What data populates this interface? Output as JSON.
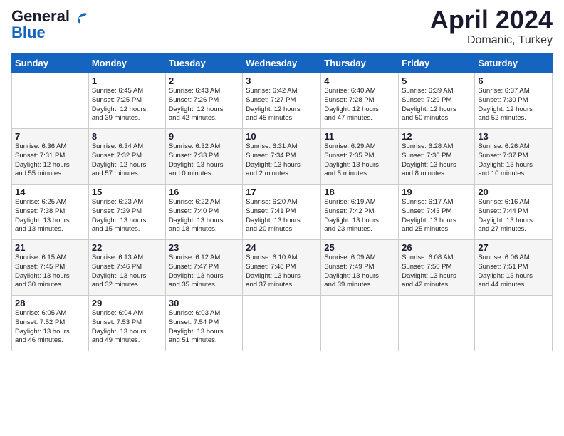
{
  "logo": {
    "part1": "General",
    "part2": "Blue"
  },
  "title": "April 2024",
  "subtitle": "Domanic, Turkey",
  "days_of_week": [
    "Sunday",
    "Monday",
    "Tuesday",
    "Wednesday",
    "Thursday",
    "Friday",
    "Saturday"
  ],
  "weeks": [
    [
      {
        "day": "",
        "content": ""
      },
      {
        "day": "1",
        "content": "Sunrise: 6:45 AM\nSunset: 7:25 PM\nDaylight: 12 hours\nand 39 minutes."
      },
      {
        "day": "2",
        "content": "Sunrise: 6:43 AM\nSunset: 7:26 PM\nDaylight: 12 hours\nand 42 minutes."
      },
      {
        "day": "3",
        "content": "Sunrise: 6:42 AM\nSunset: 7:27 PM\nDaylight: 12 hours\nand 45 minutes."
      },
      {
        "day": "4",
        "content": "Sunrise: 6:40 AM\nSunset: 7:28 PM\nDaylight: 12 hours\nand 47 minutes."
      },
      {
        "day": "5",
        "content": "Sunrise: 6:39 AM\nSunset: 7:29 PM\nDaylight: 12 hours\nand 50 minutes."
      },
      {
        "day": "6",
        "content": "Sunrise: 6:37 AM\nSunset: 7:30 PM\nDaylight: 12 hours\nand 52 minutes."
      }
    ],
    [
      {
        "day": "7",
        "content": "Sunrise: 6:36 AM\nSunset: 7:31 PM\nDaylight: 12 hours\nand 55 minutes."
      },
      {
        "day": "8",
        "content": "Sunrise: 6:34 AM\nSunset: 7:32 PM\nDaylight: 12 hours\nand 57 minutes."
      },
      {
        "day": "9",
        "content": "Sunrise: 6:32 AM\nSunset: 7:33 PM\nDaylight: 13 hours\nand 0 minutes."
      },
      {
        "day": "10",
        "content": "Sunrise: 6:31 AM\nSunset: 7:34 PM\nDaylight: 13 hours\nand 2 minutes."
      },
      {
        "day": "11",
        "content": "Sunrise: 6:29 AM\nSunset: 7:35 PM\nDaylight: 13 hours\nand 5 minutes."
      },
      {
        "day": "12",
        "content": "Sunrise: 6:28 AM\nSunset: 7:36 PM\nDaylight: 13 hours\nand 8 minutes."
      },
      {
        "day": "13",
        "content": "Sunrise: 6:26 AM\nSunset: 7:37 PM\nDaylight: 13 hours\nand 10 minutes."
      }
    ],
    [
      {
        "day": "14",
        "content": "Sunrise: 6:25 AM\nSunset: 7:38 PM\nDaylight: 13 hours\nand 13 minutes."
      },
      {
        "day": "15",
        "content": "Sunrise: 6:23 AM\nSunset: 7:39 PM\nDaylight: 13 hours\nand 15 minutes."
      },
      {
        "day": "16",
        "content": "Sunrise: 6:22 AM\nSunset: 7:40 PM\nDaylight: 13 hours\nand 18 minutes."
      },
      {
        "day": "17",
        "content": "Sunrise: 6:20 AM\nSunset: 7:41 PM\nDaylight: 13 hours\nand 20 minutes."
      },
      {
        "day": "18",
        "content": "Sunrise: 6:19 AM\nSunset: 7:42 PM\nDaylight: 13 hours\nand 23 minutes."
      },
      {
        "day": "19",
        "content": "Sunrise: 6:17 AM\nSunset: 7:43 PM\nDaylight: 13 hours\nand 25 minutes."
      },
      {
        "day": "20",
        "content": "Sunrise: 6:16 AM\nSunset: 7:44 PM\nDaylight: 13 hours\nand 27 minutes."
      }
    ],
    [
      {
        "day": "21",
        "content": "Sunrise: 6:15 AM\nSunset: 7:45 PM\nDaylight: 13 hours\nand 30 minutes."
      },
      {
        "day": "22",
        "content": "Sunrise: 6:13 AM\nSunset: 7:46 PM\nDaylight: 13 hours\nand 32 minutes."
      },
      {
        "day": "23",
        "content": "Sunrise: 6:12 AM\nSunset: 7:47 PM\nDaylight: 13 hours\nand 35 minutes."
      },
      {
        "day": "24",
        "content": "Sunrise: 6:10 AM\nSunset: 7:48 PM\nDaylight: 13 hours\nand 37 minutes."
      },
      {
        "day": "25",
        "content": "Sunrise: 6:09 AM\nSunset: 7:49 PM\nDaylight: 13 hours\nand 39 minutes."
      },
      {
        "day": "26",
        "content": "Sunrise: 6:08 AM\nSunset: 7:50 PM\nDaylight: 13 hours\nand 42 minutes."
      },
      {
        "day": "27",
        "content": "Sunrise: 6:06 AM\nSunset: 7:51 PM\nDaylight: 13 hours\nand 44 minutes."
      }
    ],
    [
      {
        "day": "28",
        "content": "Sunrise: 6:05 AM\nSunset: 7:52 PM\nDaylight: 13 hours\nand 46 minutes."
      },
      {
        "day": "29",
        "content": "Sunrise: 6:04 AM\nSunset: 7:53 PM\nDaylight: 13 hours\nand 49 minutes."
      },
      {
        "day": "30",
        "content": "Sunrise: 6:03 AM\nSunset: 7:54 PM\nDaylight: 13 hours\nand 51 minutes."
      },
      {
        "day": "",
        "content": ""
      },
      {
        "day": "",
        "content": ""
      },
      {
        "day": "",
        "content": ""
      },
      {
        "day": "",
        "content": ""
      }
    ]
  ]
}
